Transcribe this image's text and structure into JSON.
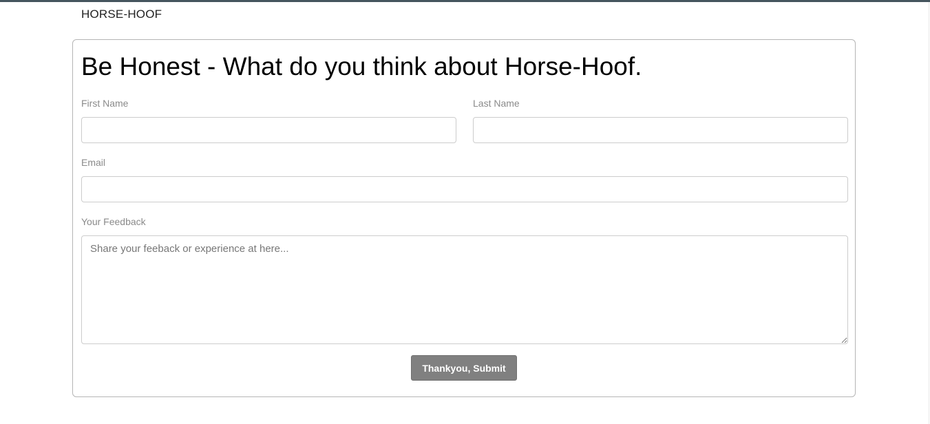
{
  "brand": "HORSE-HOOF",
  "form": {
    "title": "Be Honest - What do you think about Horse-Hoof.",
    "first_name_label": "First Name",
    "first_name_value": "",
    "last_name_label": "Last Name",
    "last_name_value": "",
    "email_label": "Email",
    "email_value": "",
    "feedback_label": "Your Feedback",
    "feedback_placeholder": "Share your feeback or experience at here...",
    "submit_label": "Thankyou, Submit"
  },
  "colors": {
    "topbar": "#46555e",
    "button": "#808080"
  }
}
